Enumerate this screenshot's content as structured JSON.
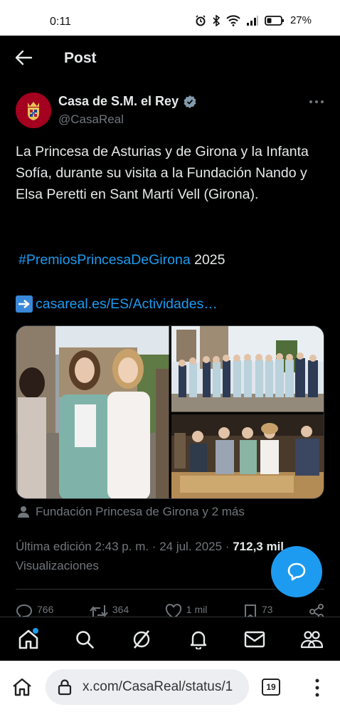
{
  "status_bar": {
    "time": "0:11",
    "battery": "27%"
  },
  "header": {
    "title": "Post"
  },
  "author": {
    "name": "Casa de S.M. el Rey",
    "handle": "@CasaReal"
  },
  "tweet": {
    "text": "La Princesa de Asturias y de Girona y la Infanta Sofía, durante su visita a la Fundación Nando y Elsa Peretti en Sant Martí Vell (Girona).",
    "hashtag": "#PremiosPrincesaDeGirona",
    "year": "2025",
    "link": "casareal.es/ES/Actividades…"
  },
  "tagged": "Fundación Princesa de Girona y 2 más",
  "meta": {
    "edited": "Última edición 2:43 p. m. · 24 jul. 2025 · ",
    "views_count": "712,3 mil",
    "views_label": "Visualizaciones"
  },
  "actions": {
    "replies": "766",
    "reposts": "364",
    "likes": "1 mil",
    "bookmarks": "73"
  },
  "browser": {
    "url": "x.com/CasaReal/status/1",
    "tab_count": "19"
  },
  "colors": {
    "accent": "#1d9bf0",
    "background": "#000000",
    "muted": "#71767b"
  },
  "icons": {
    "nav": [
      "home-icon",
      "search-icon",
      "grok-icon",
      "notifications-icon",
      "messages-icon",
      "communities-icon"
    ]
  }
}
